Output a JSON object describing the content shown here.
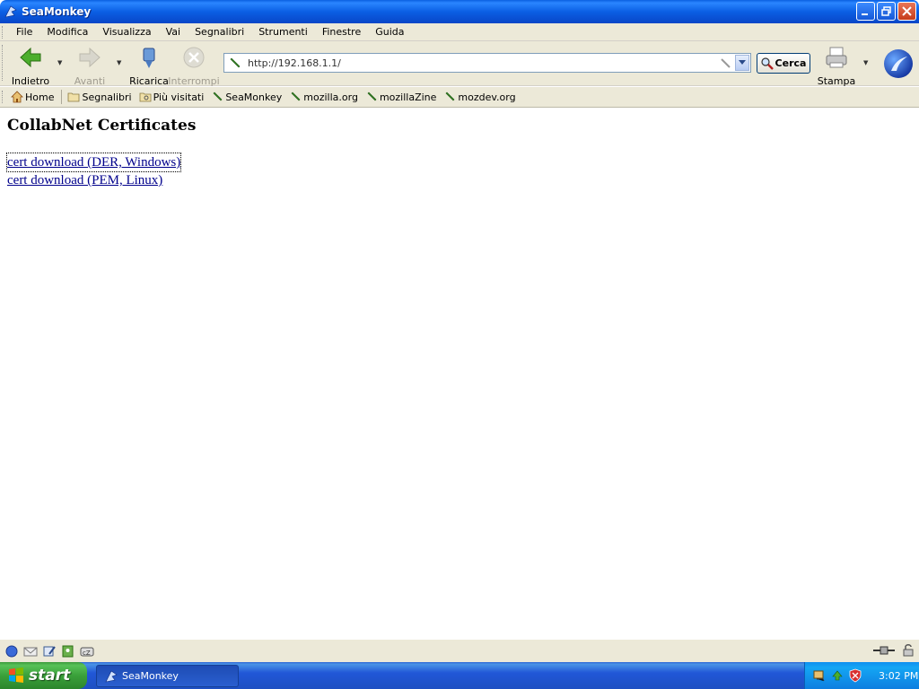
{
  "window": {
    "title": "SeaMonkey"
  },
  "menu": [
    {
      "label": "File"
    },
    {
      "label": "Modifica"
    },
    {
      "label": "Visualizza"
    },
    {
      "label": "Vai"
    },
    {
      "label": "Segnalibri"
    },
    {
      "label": "Strumenti"
    },
    {
      "label": "Finestre"
    },
    {
      "label": "Guida"
    }
  ],
  "nav": {
    "back": "Indietro",
    "forward": "Avanti",
    "reload": "Ricarica",
    "stop": "Interrompi",
    "print": "Stampa",
    "search": "Cerca"
  },
  "urlbar": {
    "value": "http://192.168.1.1/"
  },
  "personal": [
    {
      "label": "Home"
    },
    {
      "label": "Segnalibri"
    },
    {
      "label": "Più visitati"
    },
    {
      "label": "SeaMonkey"
    },
    {
      "label": "mozilla.org"
    },
    {
      "label": "mozillaZine"
    },
    {
      "label": "mozdev.org"
    }
  ],
  "page": {
    "heading": "CollabNet Certificates",
    "links": [
      {
        "label": "cert download (DER, Windows)"
      },
      {
        "label": "cert download (PEM, Linux)"
      }
    ]
  },
  "taskbar": {
    "start": "start",
    "task": "SeaMonkey",
    "clock": "3:02 PM"
  },
  "colors": {
    "link": "#00008b",
    "titlebar": "#0b5fe4",
    "chrome": "#ece9d8"
  }
}
